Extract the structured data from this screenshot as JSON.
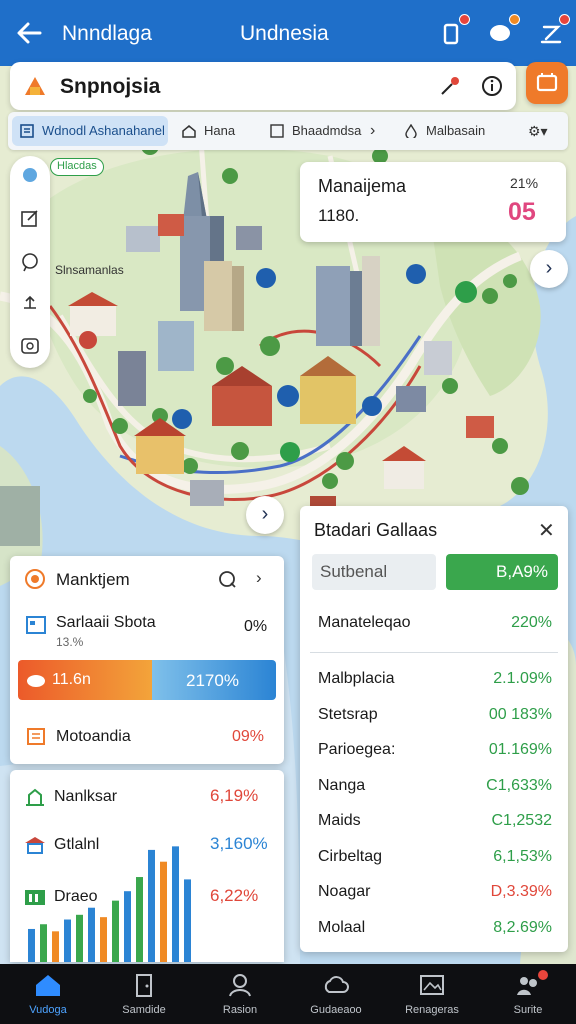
{
  "appbar": {
    "title_left": "Nnndlaga",
    "title_center": "Undnesia",
    "icons": [
      "back-arrow-icon",
      "phone-icon",
      "chat-bubble-icon",
      "edit-icon"
    ]
  },
  "search": {
    "title": "Snpnojsia",
    "icons": [
      "pin-tool-icon",
      "info-icon"
    ]
  },
  "filters": [
    {
      "label": "Wdnodl Ashanahanel",
      "icon": "list-icon",
      "active": true
    },
    {
      "label": "Hana",
      "icon": "home-icon",
      "active": false
    },
    {
      "label": "Bhaadmdsa",
      "icon": "image-icon",
      "active": false
    },
    {
      "label": "Malbasain",
      "icon": "drop-icon",
      "active": false
    }
  ],
  "map": {
    "tag_green": "Hlacdas",
    "area_label": "Slnsamanlas",
    "info_card": {
      "title": "Manaijema",
      "value": "1180.",
      "percent": "21%",
      "brand": "05"
    }
  },
  "stats_panel": {
    "title": "Btadari Gallaas",
    "sub_label": "Sutbenal",
    "sub_value": "B,A9%",
    "highlight": {
      "name": "Manateleqao",
      "value": "220%",
      "color": "#2e9e49"
    },
    "rows": [
      {
        "name": "Malbplacia",
        "value": "2.1.09%",
        "color": "#2e9e49"
      },
      {
        "name": "Stetsrap",
        "value": "00 183%",
        "color": "#2e9e49"
      },
      {
        "name": "Parioegea:",
        "value": "01.169%",
        "color": "#2e9e49"
      },
      {
        "name": "Nanga",
        "value": "C1,633%",
        "color": "#2e9e49"
      },
      {
        "name": "Maids",
        "value": "C1,2532",
        "color": "#2e9e49"
      },
      {
        "name": "Cirbeltag",
        "value": "6,1,53%",
        "color": "#2e9e49"
      },
      {
        "name": "Noagar",
        "value": "D,3.39%",
        "color": "#e0473a"
      },
      {
        "name": "Molaal",
        "value": "8,2.69%",
        "color": "#2e9e49"
      }
    ]
  },
  "card1": {
    "title": "Manktjem",
    "row1": {
      "name": "Sarlaaii Sbota",
      "sub": "13.%",
      "value": "0%"
    },
    "bar": {
      "left_label": "11.6n",
      "right_label": "2170%",
      "split_fraction": 0.52
    },
    "row2": {
      "name": "Motoandia",
      "value": "09%"
    }
  },
  "card2": {
    "rows": [
      {
        "name": "Nanlksar",
        "value": "6,19%",
        "color": "#e0473a",
        "icon": "building-icon"
      },
      {
        "name": "Gtlalnl",
        "value": "3,160%",
        "color": "#2b84d4",
        "icon": "temple-icon"
      },
      {
        "name": "Draeo",
        "value": "6,22%",
        "color": "#e0473a",
        "icon": "chart-icon"
      }
    ],
    "bars": [
      {
        "value": 0.28,
        "color": "#2b84d4"
      },
      {
        "value": 0.32,
        "color": "#3aa74d"
      },
      {
        "value": 0.26,
        "color": "#f08a24"
      },
      {
        "value": 0.36,
        "color": "#2b84d4"
      },
      {
        "value": 0.4,
        "color": "#3aa74d"
      },
      {
        "value": 0.46,
        "color": "#2b84d4"
      },
      {
        "value": 0.38,
        "color": "#f08a24"
      },
      {
        "value": 0.52,
        "color": "#3aa74d"
      },
      {
        "value": 0.6,
        "color": "#2b84d4"
      },
      {
        "value": 0.72,
        "color": "#3aa74d"
      },
      {
        "value": 0.95,
        "color": "#2b84d4"
      },
      {
        "value": 0.85,
        "color": "#f08a24"
      },
      {
        "value": 0.98,
        "color": "#2b84d4"
      },
      {
        "value": 0.7,
        "color": "#2b84d4"
      }
    ]
  },
  "bottomnav": [
    {
      "label": "Vudoga",
      "icon": "home-icon",
      "active": true
    },
    {
      "label": "Samdide",
      "icon": "door-icon",
      "active": false
    },
    {
      "label": "Rasion",
      "icon": "person-icon",
      "active": false
    },
    {
      "label": "Gudaeaoo",
      "icon": "cloud-icon",
      "active": false
    },
    {
      "label": "Renageras",
      "icon": "gallery-icon",
      "active": false
    },
    {
      "label": "Surite",
      "icon": "group-icon",
      "active": false
    }
  ]
}
